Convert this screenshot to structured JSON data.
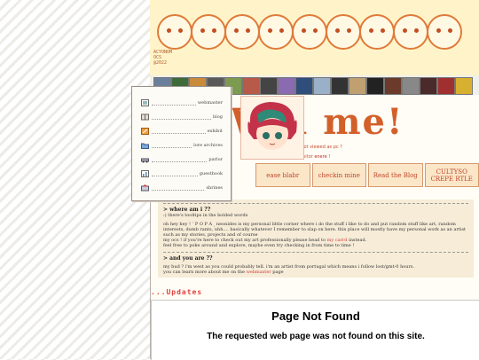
{
  "banner": {
    "signature_lines": [
      "ACYONOM",
      "OCS",
      "@2022"
    ]
  },
  "nav": {
    "items": [
      {
        "label": "webmaster",
        "icon": "gallery-icon"
      },
      {
        "label": "blog",
        "icon": "book-icon"
      },
      {
        "label": "exhibit",
        "icon": "pencil-box-icon"
      },
      {
        "label": "lore archives",
        "icon": "folder-icon"
      },
      {
        "label": "parlor",
        "icon": "car-icon"
      },
      {
        "label": "guestbook",
        "icon": "chart-icon"
      },
      {
        "label": "shrines",
        "icon": "mailbox-icon"
      }
    ]
  },
  "hero": {
    "welcome_text": "Wel me!",
    "line1": "take this site is not viewed as pc ?",
    "line2": "haulty visitor",
    "line2_emph": "enere !"
  },
  "stickers": [
    "ease blabr",
    "checkin mine",
    "Read the Blog",
    "CULTYSO CREPE RTLE"
  ],
  "info": {
    "where_heading": "> where am i ??",
    "where_sub": ":) there's tooltips in the bolded words",
    "where_body_1": "oh hey hey ! ˹ P O P A ˼ neonides is my personal little corner where i do the stuff i like to do and put random stuff like art, random interests, dumb rants, uhh.... basically whatever I remember to slap on here. this place will mostly have my personal work as an artist such as my stories, projects and of course",
    "where_body_2_pre": "my ocs ! if you're here to check out my art professionally please head to",
    "where_body_2_link": "my carrd",
    "where_body_2_post": "instead.",
    "where_body_3": "feel free to poke around and explore, maybe even try checking in from time to time !",
    "you_heading": "> and you are ??",
    "you_body_1": "my bud ? i'm west as you could probably tell. i'm an artist from portugal which means i follow lost/gmt-0 hours.",
    "you_body_2_pre": "you can learn more about me on the",
    "you_body_2_link": "webmaster",
    "you_body_2_post": "page"
  },
  "updates": {
    "title": "...Updates"
  },
  "iframe": {
    "error_title": "Page Not Found",
    "error_body": "The requested web page was not found on this site."
  },
  "colors": {
    "accent": "#d3602a",
    "link": "#d13838",
    "banner_bg": "#fff4c9",
    "info_bg": "#f6ecd8"
  }
}
